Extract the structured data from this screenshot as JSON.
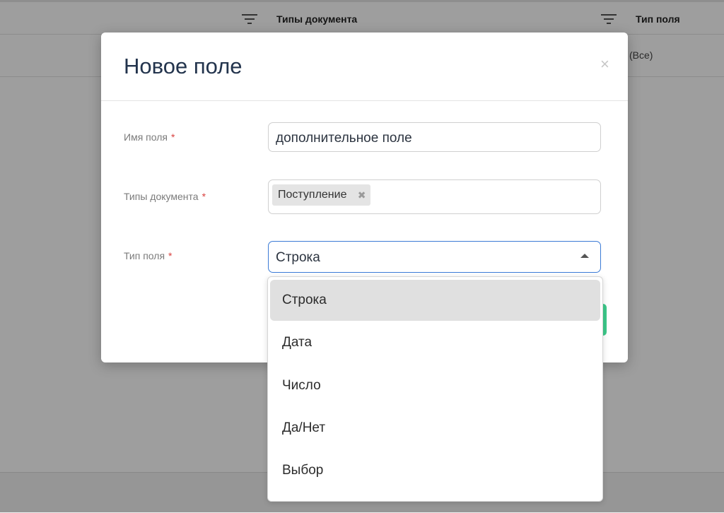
{
  "background": {
    "columns": [
      {
        "label": "Типы документа"
      },
      {
        "label": "Тип поля"
      }
    ],
    "filter_value": "(Все)"
  },
  "modal": {
    "title": "Новое поле",
    "close_glyph": "×",
    "required_mark": "*",
    "fields": {
      "name": {
        "label": "Имя поля",
        "value": "дополнительное поле"
      },
      "doc_types": {
        "label": "Типы документа",
        "tags": [
          {
            "label": "Поступление",
            "remove_glyph": "✖"
          }
        ]
      },
      "field_type": {
        "label": "Тип поля",
        "value": "Строка"
      }
    }
  },
  "dropdown": {
    "options": [
      "Строка",
      "Дата",
      "Число",
      "Да/Нет",
      "Выбор"
    ],
    "selected": "Строка"
  },
  "colors": {
    "title": "#23344d",
    "required": "#d9413f",
    "focus_border": "#3b7bd6",
    "save_button": "#3cc98a"
  },
  "icons": {
    "filter": "filter-icon",
    "close": "close-icon",
    "tag_remove": "remove-tag-icon",
    "caret": "caret-up-icon"
  }
}
